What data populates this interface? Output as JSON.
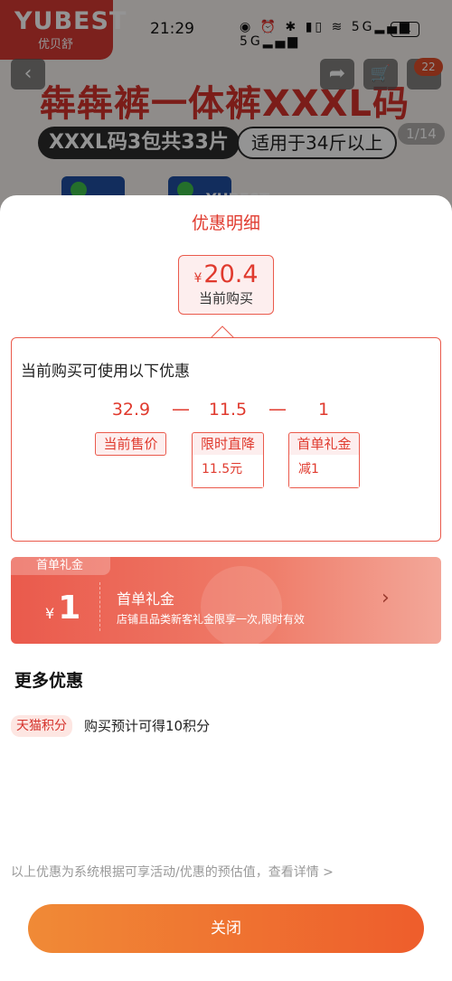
{
  "background": {
    "brand": "YUBEST",
    "brand_sub": "优贝舒",
    "status": {
      "time": "21:29",
      "signal_icons": "◉ ⏰ ✱ ▮▯ ≋ 5G▂▄▆ 5G▂▄▆",
      "battery": "31"
    },
    "back_glyph": "‹",
    "share_glyph": "➦",
    "cart_glyph": "🛒",
    "cart_badge": "22",
    "headline": "犇犇裤一体裤XXXL码",
    "pill_dark": "XXXL码3包共33片",
    "pill_light": "适用于34斤以上",
    "image_index": "1/14",
    "pack_text": "YUBEST"
  },
  "sheet": {
    "title": "优惠明细",
    "current_price": {
      "currency": "¥",
      "amount": "20.4",
      "label": "当前购买"
    },
    "detail": {
      "heading": "当前购买可使用以下优惠",
      "values": [
        "32.9",
        "11.5",
        "1"
      ],
      "ops": [
        "—",
        "—"
      ],
      "tags": [
        {
          "label": "当前售价",
          "sub": ""
        },
        {
          "label": "限时直降",
          "sub": "11.5元"
        },
        {
          "label": "首单礼金",
          "sub": "减1"
        }
      ]
    },
    "coupon": {
      "tag": "首单礼金",
      "currency": "¥",
      "amount": "1",
      "name": "首单礼金",
      "desc": "店铺且品类新客礼金限享一次,限时有效",
      "arrow": "›"
    },
    "more": {
      "title": "更多优惠",
      "points_tag": "天猫积分",
      "points_text": "购买预计可得10积分"
    },
    "footnote": "以上优惠为系统根据可享活动/优惠的预估值，查看详情 >",
    "close_label": "关闭"
  },
  "colors": {
    "accent": "#e03a2e",
    "coupon": "#ea5a4c",
    "button_start": "#f08a36",
    "button_end": "#ee5d2c"
  }
}
